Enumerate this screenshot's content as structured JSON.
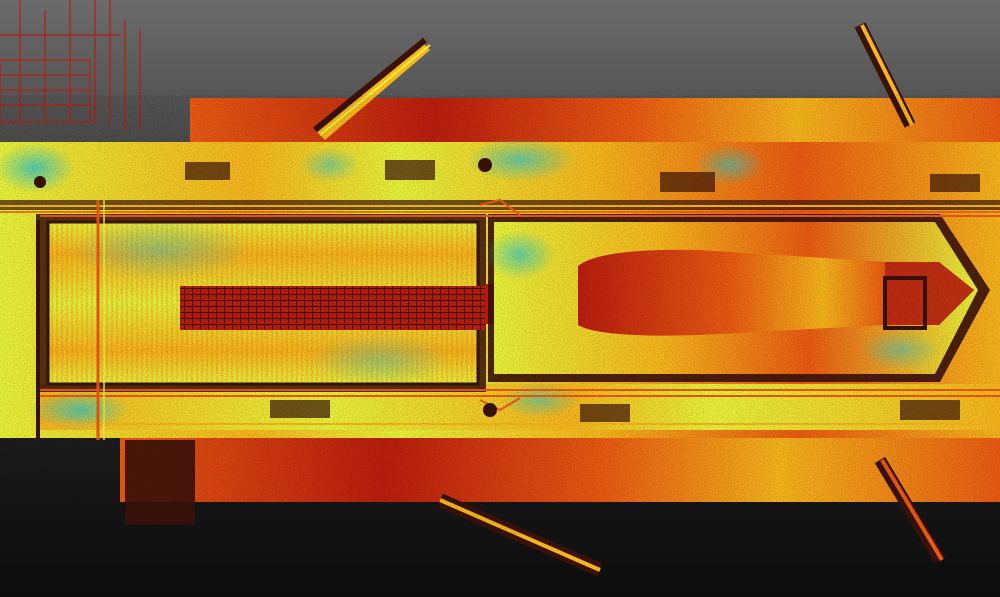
{
  "scene": {
    "kind": "point-cloud-intensity-topview",
    "subject": "ship-deck",
    "background_gradient": [
      "#6b6b6b",
      "#2e2e2e",
      "#0c0c0c"
    ],
    "colormap": {
      "low": "#2ec4c8",
      "mid_low": "#e8f23a",
      "mid": "#f6b51c",
      "mid_high": "#ea5a12",
      "high": "#b81d0e",
      "dark": "#3a120a"
    },
    "components": {
      "hull": "hull-deck",
      "cargo_hold": "central-cargo-hold",
      "hatch_grate": "hatch-grate",
      "bow_ramp": "bow-ramp",
      "upper_side_deck": "upper-side-deck",
      "lower_side_deck": "lower-side-deck",
      "pipe_runs": "pipe-runs",
      "winches": "deck-winches",
      "cranes": "loading-cranes",
      "scaffold": "scaffold-tower"
    }
  }
}
